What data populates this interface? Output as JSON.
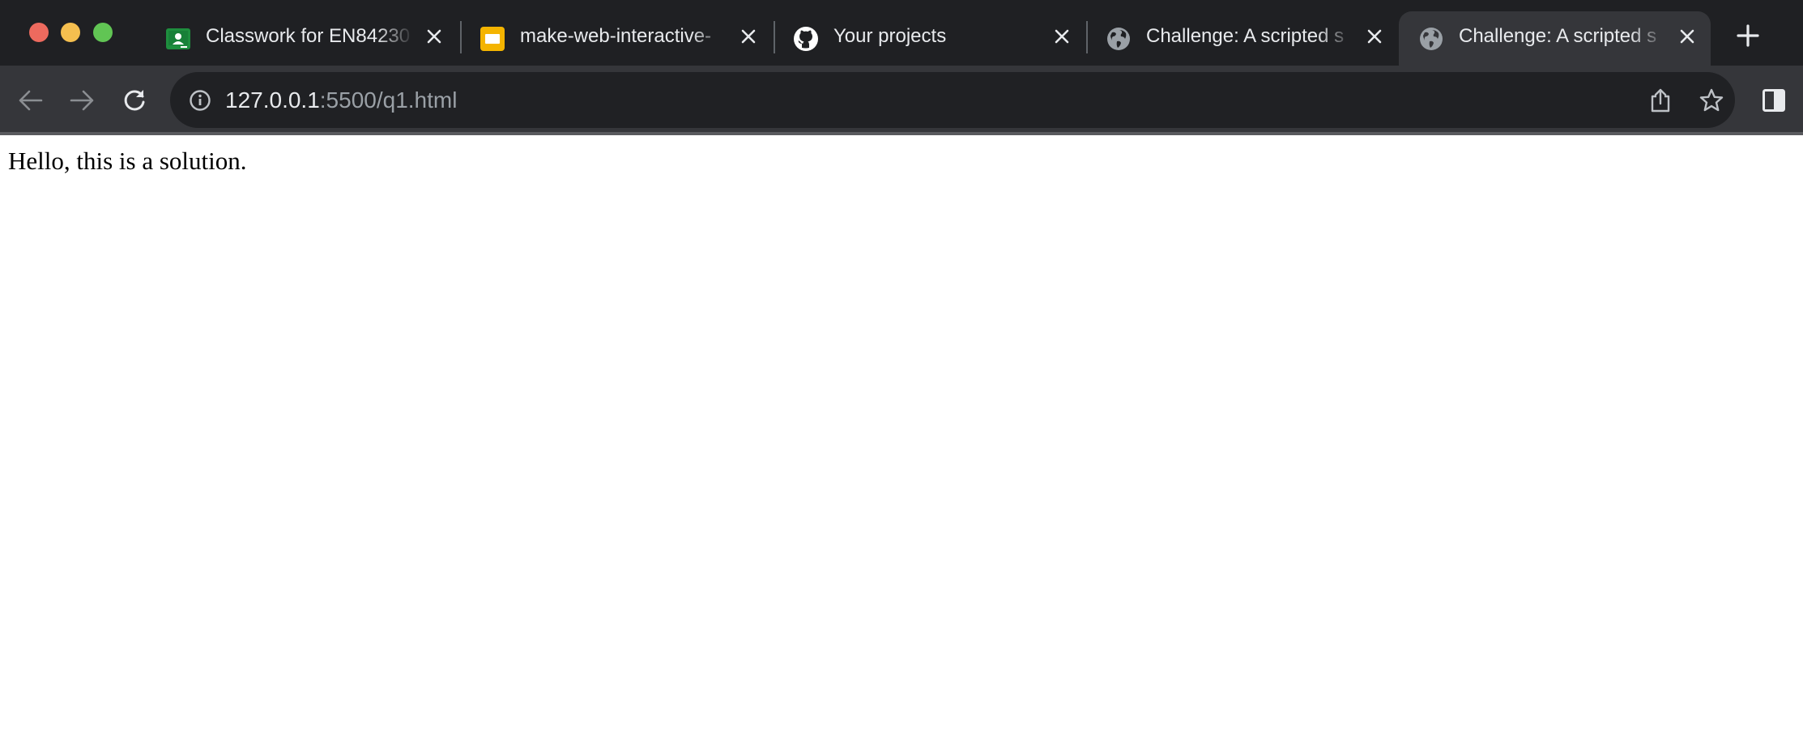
{
  "window": {
    "traffic_lights": [
      "close",
      "minimize",
      "zoom"
    ]
  },
  "tabs": [
    {
      "title": "Classwork for EN84230",
      "favicon": "google-classroom-icon",
      "active": false
    },
    {
      "title": "make-web-interactive-",
      "favicon": "google-slides-icon",
      "active": false
    },
    {
      "title": "Your projects",
      "favicon": "github-icon",
      "active": false
    },
    {
      "title": "Challenge: A scripted s",
      "favicon": "globe-icon",
      "active": false
    },
    {
      "title": "Challenge: A scripted s",
      "favicon": "globe-icon",
      "active": true
    }
  ],
  "toolbar": {
    "url_host": "127.0.0.1",
    "url_rest": ":5500/q1.html",
    "icons": [
      "back-arrow-icon",
      "forward-arrow-icon",
      "reload-icon",
      "info-icon",
      "share-icon",
      "star-icon",
      "side-panel-icon"
    ]
  },
  "page": {
    "text": "Hello, this is a solution."
  },
  "colors": {
    "tabstrip_bg": "#1f2023",
    "toolbar_bg": "#35363a",
    "omnibox_bg": "#202124",
    "text_primary": "#e8eaed",
    "text_secondary": "#9aa0a6",
    "classroom_green": "#1e8e3e",
    "slides_yellow": "#f4b400"
  }
}
